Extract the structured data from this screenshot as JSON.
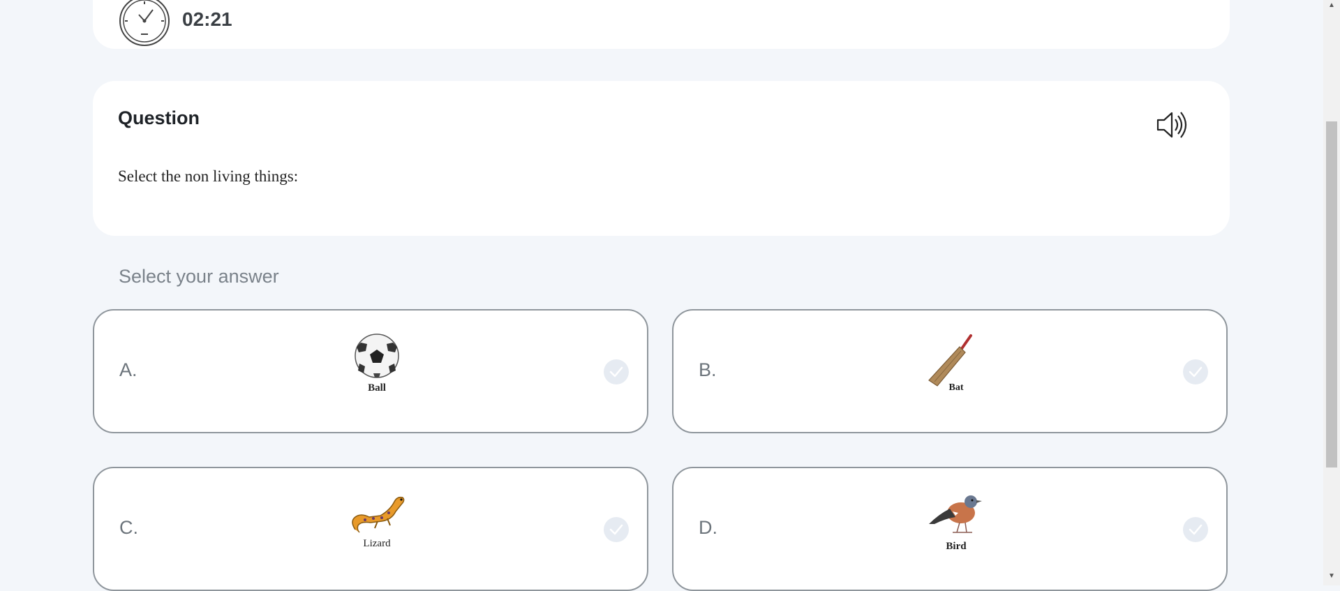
{
  "timer": {
    "value": "02:21"
  },
  "question": {
    "heading": "Question",
    "text": "Select the non living things:"
  },
  "answers": {
    "heading": "Select your answer",
    "options": [
      {
        "letter": "A.",
        "caption": "Ball",
        "image": "soccer-ball-image"
      },
      {
        "letter": "B.",
        "caption": "Bat",
        "image": "cricket-bat-image"
      },
      {
        "letter": "C.",
        "caption": "Lizard",
        "image": "lizard-image"
      },
      {
        "letter": "D.",
        "caption": "Bird",
        "image": "bird-image"
      }
    ]
  },
  "icons": {
    "timer": "clock-icon",
    "speaker": "speaker-icon",
    "check": "check-icon"
  },
  "colors": {
    "background": "#f3f6fa",
    "card": "#ffffff",
    "option_border": "#8f969c",
    "check_bg": "#e6ebf2",
    "muted_text": "#7a828a"
  }
}
